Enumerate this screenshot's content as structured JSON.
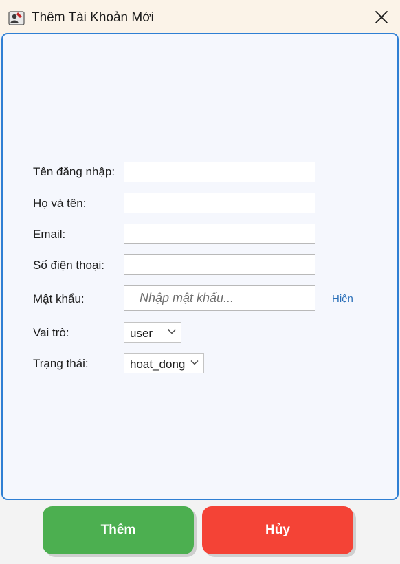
{
  "window": {
    "title": "Thêm Tài Khoản Mới"
  },
  "form": {
    "username": {
      "label": "Tên đăng nhập:",
      "value": ""
    },
    "fullname": {
      "label": "Họ và tên:",
      "value": ""
    },
    "email": {
      "label": "Email:",
      "value": ""
    },
    "phone": {
      "label": "Số điện thoại:",
      "value": ""
    },
    "password": {
      "label": "Mật khẩu:",
      "placeholder": "Nhập mật khẩu...",
      "toggle_label": "Hiện"
    },
    "role": {
      "label": "Vai trò:",
      "selected": "user"
    },
    "status": {
      "label": "Trạng thái:",
      "selected": "hoat_dong"
    }
  },
  "buttons": {
    "add_label": "Thêm",
    "cancel_label": "Hủy"
  },
  "colors": {
    "accent": "#2f7fd4",
    "add_button": "#4caf50",
    "cancel_button": "#f44336",
    "link": "#2a6fb8"
  },
  "icons": {
    "app": "user-card-icon",
    "close": "close-icon",
    "dropdown": "chevron-down-icon"
  }
}
